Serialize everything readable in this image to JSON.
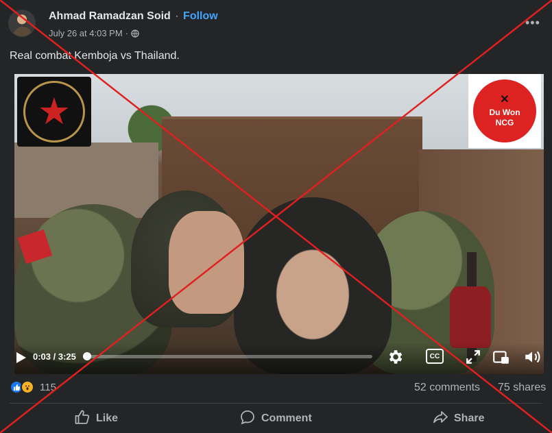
{
  "post": {
    "author": "Ahmad Ramadzan Soid",
    "separator": "·",
    "follow_label": "Follow",
    "timestamp": "July 26 at 4:03 PM",
    "timestamp_separator": "·",
    "audience_icon": "globe-icon",
    "more_icon": "more-options-icon",
    "more_glyph": "•••",
    "caption": "Real combat Kemboja vs Thailand."
  },
  "video": {
    "current_time": "0:03",
    "time_separator": " / ",
    "duration": "3:25",
    "progress_fraction": 0.015,
    "cc_label": "CC",
    "logo_left_icon": "star-emblem-icon",
    "logo_right_icon": "crossed-rifles-emblem-icon",
    "logo_right_text": "Du Won",
    "logo_right_abbrev": "NCG"
  },
  "stats": {
    "reaction_icons": [
      "like-reaction-icon",
      "wow-reaction-icon"
    ],
    "reaction_count": "115",
    "comments": "52 comments",
    "shares": "75 shares"
  },
  "actions": {
    "like_label": "Like",
    "comment_label": "Comment",
    "share_label": "Share"
  },
  "colors": {
    "background": "#242526",
    "text_primary": "#e4e6eb",
    "text_secondary": "#b0b3b8",
    "follow": "#3ea6ff",
    "cross_overlay": "#e02020"
  }
}
